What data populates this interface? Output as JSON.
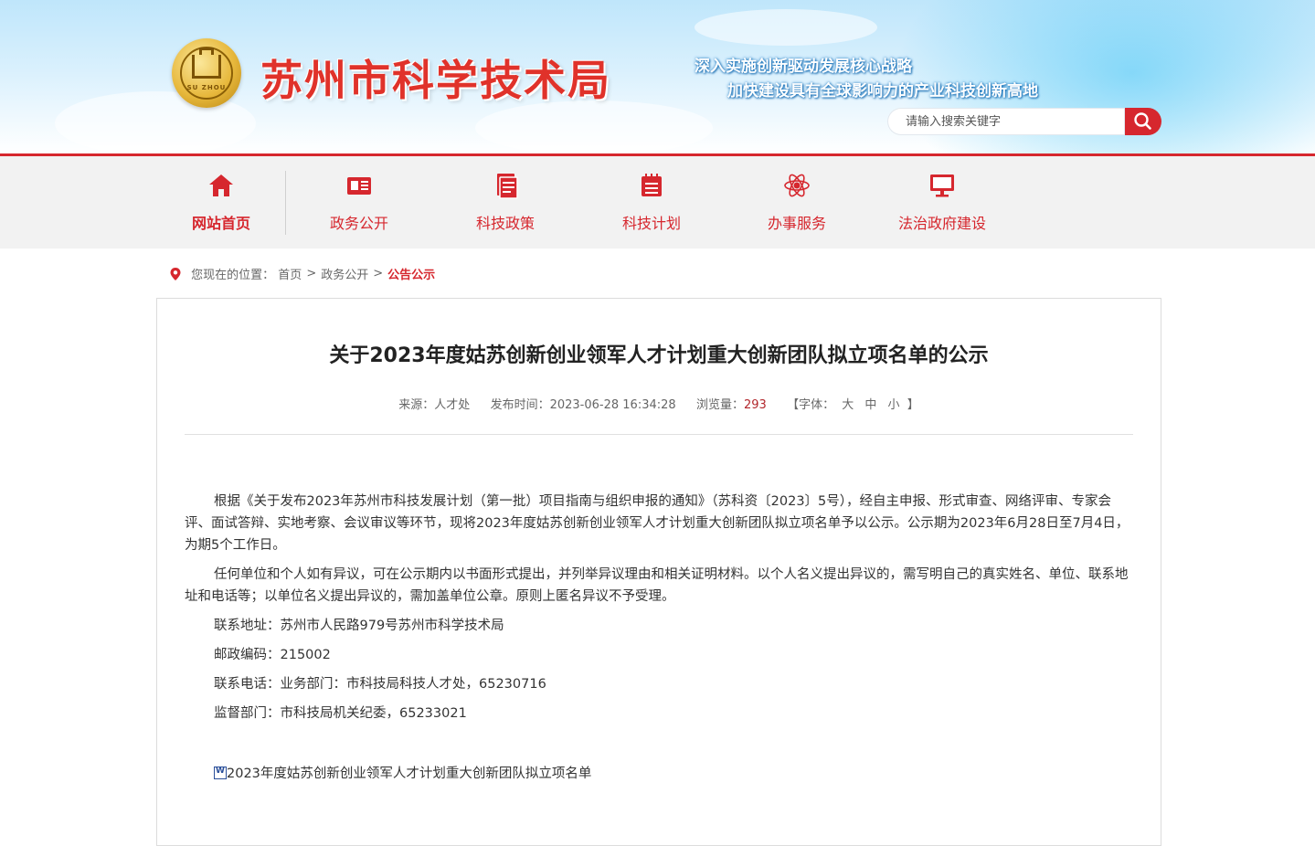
{
  "header": {
    "site_title": "苏州市科学技术局",
    "emblem_text": "SU ZHOU",
    "slogan_line1": "深入实施创新驱动发展核心战略",
    "slogan_line2": "加快建设具有全球影响力的产业科技创新高地",
    "search": {
      "placeholder": "请输入搜索关键字",
      "icon": "search-icon"
    }
  },
  "colors": {
    "accent": "#d6272e",
    "title_red": "#e0322a",
    "nav_bg": "#f2f2f2"
  },
  "nav": {
    "items": [
      {
        "label": "网站首页",
        "icon": "home-icon",
        "active": true
      },
      {
        "label": "政务公开",
        "icon": "id-card-icon",
        "active": false
      },
      {
        "label": "科技政策",
        "icon": "document-icon",
        "active": false
      },
      {
        "label": "科技计划",
        "icon": "calendar-list-icon",
        "active": false
      },
      {
        "label": "办事服务",
        "icon": "atom-icon",
        "active": false
      },
      {
        "label": "法治政府建设",
        "icon": "monitor-icon",
        "active": false
      }
    ]
  },
  "breadcrumb": {
    "prefix": "您现在的位置：",
    "items": [
      "首页",
      "政务公开"
    ],
    "current": "公告公示",
    "separator": ">"
  },
  "article": {
    "title": "关于2023年度姑苏创新创业领军人才计划重大创新团队拟立项名单的公示",
    "meta": {
      "source_label": "来源：",
      "source": "人才处",
      "published_label": "发布时间：",
      "published": "2023-06-28 16:34:28",
      "views_label": "浏览量：",
      "views": "293",
      "font_label": "【字体：",
      "font_large": "大",
      "font_medium": "中",
      "font_small": "小",
      "font_close": "】"
    },
    "paragraphs": [
      "根据《关于发布2023年苏州市科技发展计划（第一批）项目指南与组织申报的通知》（苏科资〔2023〕5号），经自主申报、形式审查、网络评审、专家会评、面试答辩、实地考察、会议审议等环节，现将2023年度姑苏创新创业领军人才计划重大创新团队拟立项名单予以公示。公示期为2023年6月28日至7月4日，为期5个工作日。",
      "任何单位和个人如有异议，可在公示期内以书面形式提出，并列举异议理由和相关证明材料。以个人名义提出异议的，需写明自己的真实姓名、单位、联系地址和电话等；以单位名义提出异议的，需加盖单位公章。原则上匿名异议不予受理。",
      "联系地址：苏州市人民路979号苏州市科学技术局",
      "邮政编码：215002",
      "联系电话：业务部门：市科技局科技人才处，65230716",
      "监督部门：市科技局机关纪委，65233021"
    ],
    "attachment": "2023年度姑苏创新创业领军人才计划重大创新团队拟立项名单"
  }
}
